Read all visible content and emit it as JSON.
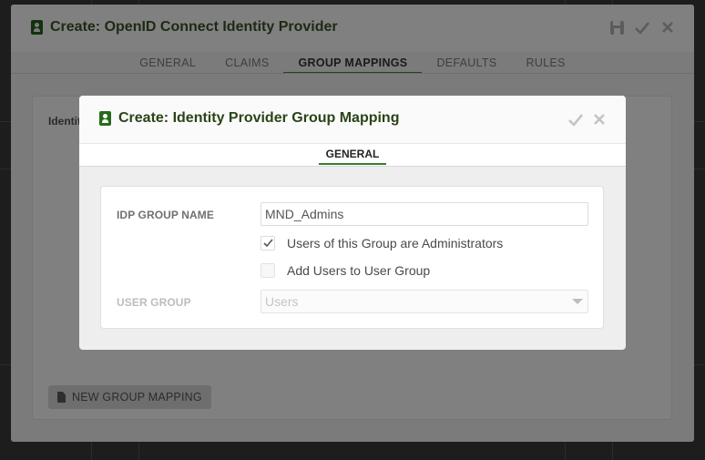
{
  "outer_dialog": {
    "title": "Create: OpenID Connect Identity Provider",
    "actions": {
      "save_icon": "floppy-disk",
      "confirm_icon": "checkmark",
      "close_icon": "x-mark"
    },
    "tabs": [
      {
        "label": "GENERAL",
        "active": false
      },
      {
        "label": "CLAIMS",
        "active": false
      },
      {
        "label": "GROUP MAPPINGS",
        "active": true
      },
      {
        "label": "DEFAULTS",
        "active": false
      },
      {
        "label": "RULES",
        "active": false
      }
    ],
    "panel": {
      "title": "Identit",
      "new_mapping_label": "NEW GROUP MAPPING"
    }
  },
  "modal": {
    "title": "Create: Identity Provider Group Mapping",
    "actions": {
      "confirm_icon": "checkmark",
      "close_icon": "x-mark"
    },
    "tab": {
      "label": "GENERAL"
    },
    "form": {
      "idp_group_name_label": "IDP GROUP NAME",
      "idp_group_name_value": "MND_Admins",
      "admin_checkbox_label": "Users of this Group are Administrators",
      "admin_checked": true,
      "add_users_checkbox_label": "Add Users to User Group",
      "add_users_checked": false,
      "user_group_label": "USER GROUP",
      "user_group_value": "Users"
    }
  },
  "colors": {
    "accent": "#3a7d2a",
    "title_green": "#2a4418"
  }
}
